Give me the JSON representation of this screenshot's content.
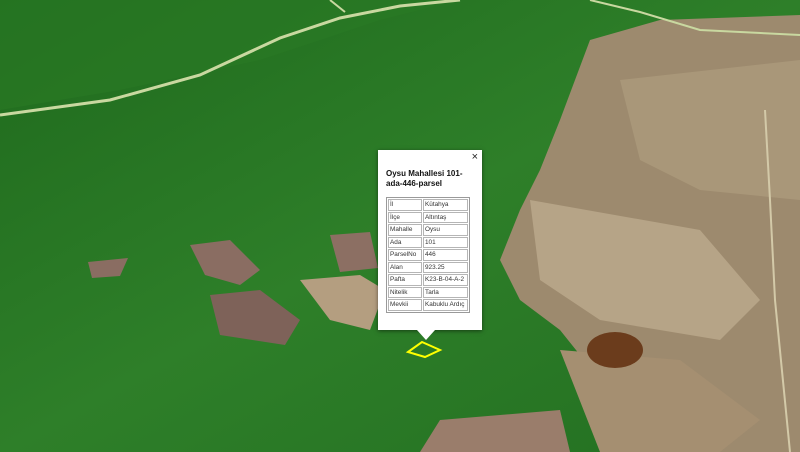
{
  "map": {
    "parcel_outline_color": "#ffff00",
    "forest_color": "#2f7a2a",
    "road_color": "#c9d8a0"
  },
  "popup": {
    "title": "Oysu Mahallesi 101-ada-446-parsel",
    "close_label": "×",
    "rows": [
      {
        "key": "İl",
        "value": "Kütahya"
      },
      {
        "key": "İlçe",
        "value": "Altıntaş"
      },
      {
        "key": "Mahalle",
        "value": "Oysu"
      },
      {
        "key": "Ada",
        "value": "101"
      },
      {
        "key": "ParselNo",
        "value": "446"
      },
      {
        "key": "Alan",
        "value": "923.25"
      },
      {
        "key": "Pafta",
        "value": "K23-B-04-A-2"
      },
      {
        "key": "Nitelik",
        "value": "Tarla"
      },
      {
        "key": "Mevkii",
        "value": "Kabuklu Ardıç"
      }
    ]
  }
}
